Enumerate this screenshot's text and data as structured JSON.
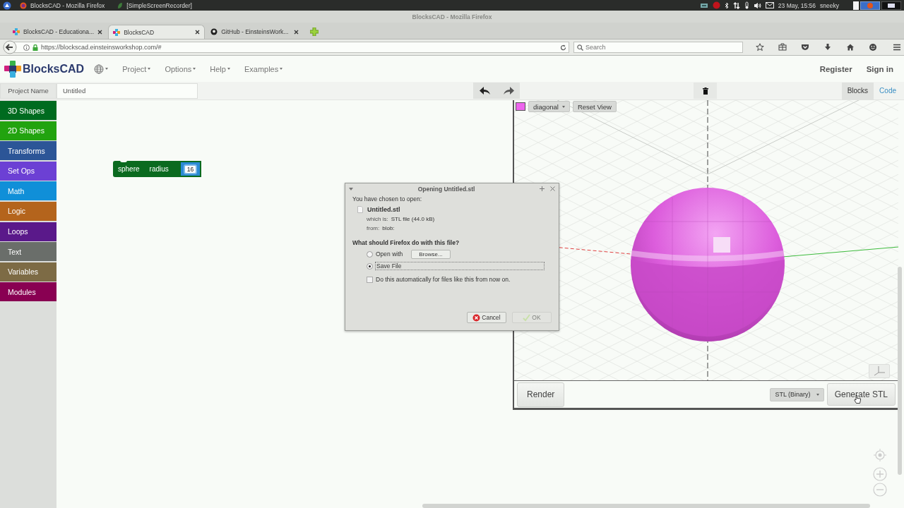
{
  "taskbar": {
    "tasks": [
      "BlocksCAD - Mozilla Firefox",
      "[SimpleScreenRecorder]"
    ],
    "clock": "23 May, 15:56",
    "user": "sneeky"
  },
  "window": {
    "title": "BlocksCAD - Mozilla Firefox"
  },
  "browser_tabs": [
    {
      "label": "BlocksCAD - Educationa...",
      "selected": false
    },
    {
      "label": "BlocksCAD",
      "selected": true
    },
    {
      "label": "GitHub - EinsteinsWork...",
      "selected": false
    }
  ],
  "address_bar": {
    "url": "https://blockscad.einsteinsworkshop.com/#"
  },
  "search_field": {
    "placeholder": "Search"
  },
  "app": {
    "brand": "BlocksCAD",
    "menus": [
      "Project",
      "Options",
      "Help",
      "Examples"
    ],
    "account_links": [
      "Register",
      "Sign in"
    ]
  },
  "toolbar": {
    "project_name_label": "Project Name",
    "project_name": "Untitled",
    "view_tabs": [
      {
        "label": "Blocks",
        "selected": true
      },
      {
        "label": "Code",
        "selected": false
      }
    ]
  },
  "categories": [
    {
      "label": "3D Shapes",
      "color": "#006b1f"
    },
    {
      "label": "2D Shapes",
      "color": "#22a30f"
    },
    {
      "label": "Transforms",
      "color": "#2c5597"
    },
    {
      "label": "Set Ops",
      "color": "#6c40d4"
    },
    {
      "label": "Math",
      "color": "#108fd8"
    },
    {
      "label": "Logic",
      "color": "#b4641c"
    },
    {
      "label": "Loops",
      "color": "#5a198a"
    },
    {
      "label": "Text",
      "color": "#6a6e6a"
    },
    {
      "label": "Variables",
      "color": "#7d6b45"
    },
    {
      "label": "Modules",
      "color": "#890052"
    }
  ],
  "block": {
    "name": "sphere",
    "param": "radius",
    "value": "16"
  },
  "viewer": {
    "view": "diagonal",
    "reset": "Reset View",
    "render": "Render",
    "format": "STL (Binary)",
    "generate": "Generate STL"
  },
  "dialog": {
    "title": "Opening Untitled.stl",
    "intro": "You have chosen to open:",
    "file_name": "Untitled.stl",
    "type_label": "which is:",
    "type_value": "STL file (44.0 kB)",
    "from_label": "from:",
    "from_value": "blob:",
    "question": "What should Firefox do with this file?",
    "actions": [
      {
        "label": "Open with",
        "selected": false
      },
      {
        "label": "Save File",
        "selected": true
      }
    ],
    "browse": "Browse...",
    "remember": {
      "label": "Do this automatically for files like this from now on.",
      "checked": false
    },
    "buttons": [
      {
        "label": "Cancel",
        "disabled": false
      },
      {
        "label": "OK",
        "disabled": true
      }
    ]
  }
}
